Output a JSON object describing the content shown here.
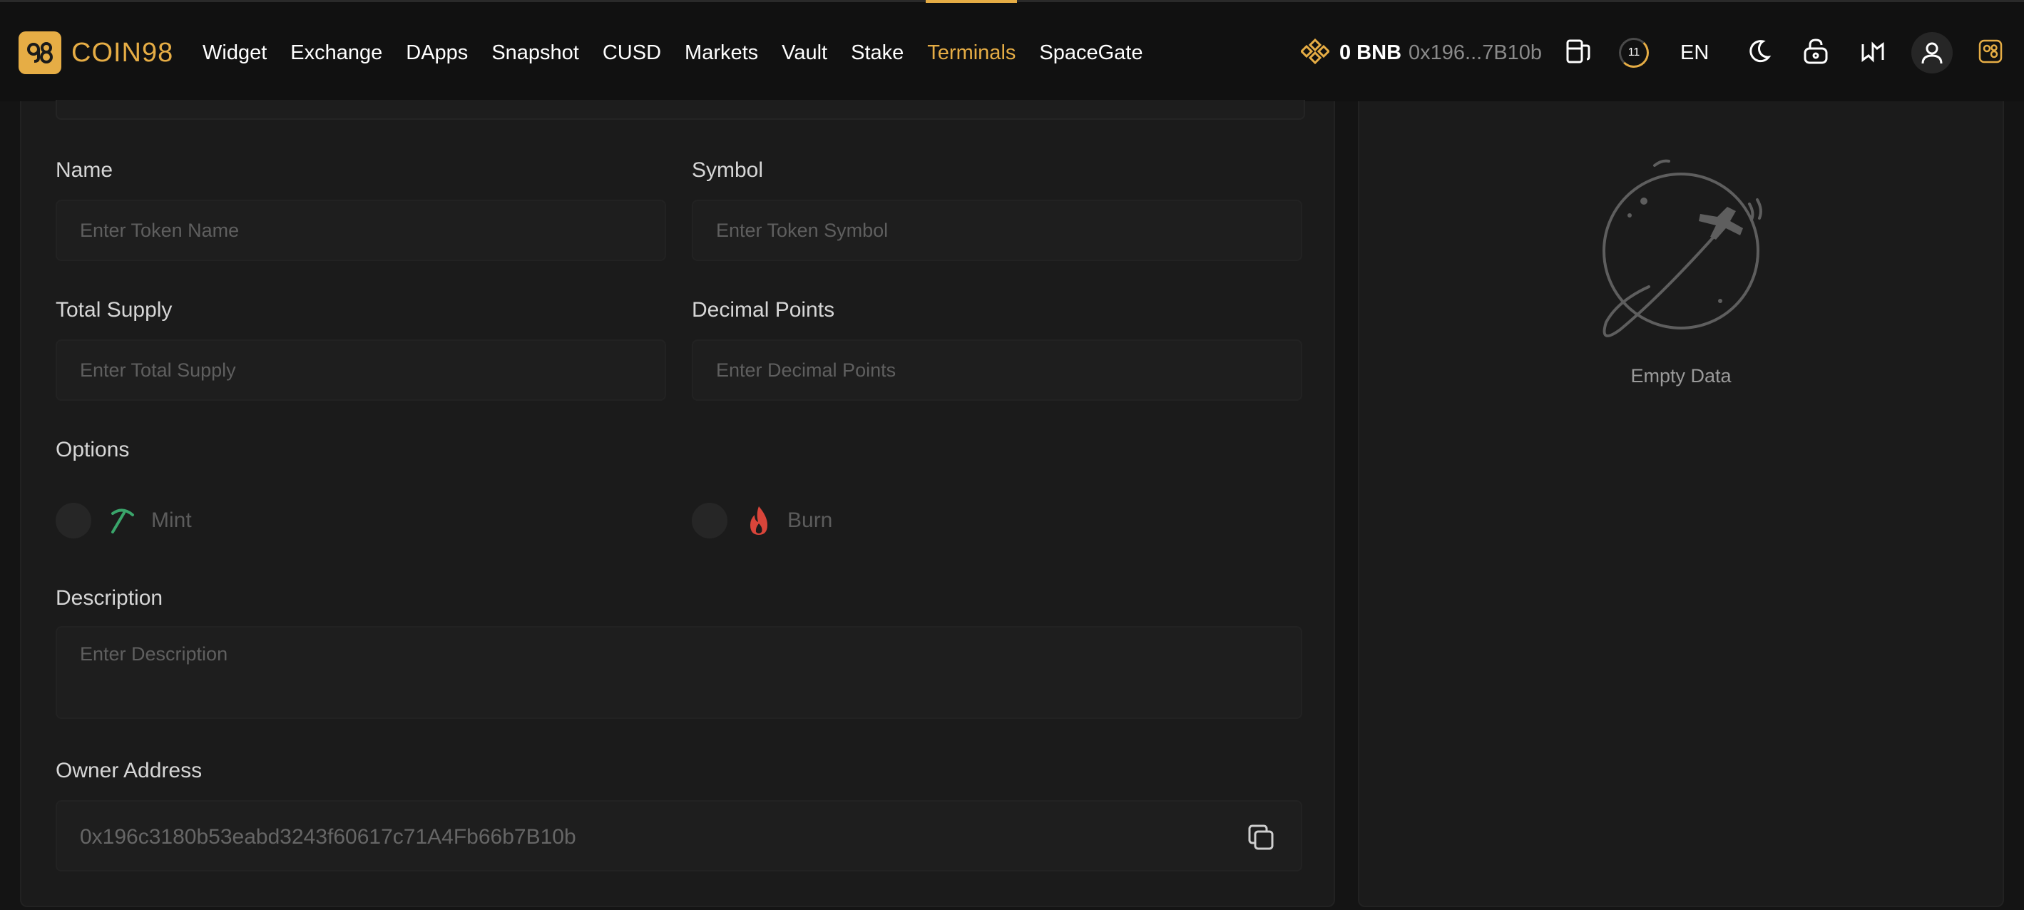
{
  "brand": {
    "logo_text": "COIN98",
    "accent": "#e6ad45"
  },
  "nav": {
    "items": [
      {
        "label": "Widget"
      },
      {
        "label": "Exchange"
      },
      {
        "label": "DApps"
      },
      {
        "label": "Snapshot"
      },
      {
        "label": "CUSD"
      },
      {
        "label": "Markets"
      },
      {
        "label": "Vault"
      },
      {
        "label": "Stake"
      },
      {
        "label": "Terminals",
        "active": true
      },
      {
        "label": "SpaceGate"
      }
    ]
  },
  "wallet": {
    "balance": "0 BNB",
    "address_short": "0x196...7B10b",
    "notification_count": "11",
    "language": "EN",
    "icons": [
      "bnb-coin-icon",
      "gas-pump-icon",
      "moon-icon",
      "unlock-icon",
      "bridge-icon",
      "user-icon",
      "coin98-app-icon"
    ]
  },
  "form": {
    "name": {
      "label": "Name",
      "placeholder": "Enter Token Name"
    },
    "symbol": {
      "label": "Symbol",
      "placeholder": "Enter Token Symbol"
    },
    "total_supply": {
      "label": "Total Supply",
      "placeholder": "Enter Total Supply"
    },
    "decimals": {
      "label": "Decimal Points",
      "placeholder": "Enter Decimal Points"
    },
    "options": {
      "label": "Options",
      "mint": {
        "label": "Mint",
        "color": "#3aa56b"
      },
      "burn": {
        "label": "Burn",
        "color": "#d9453a"
      }
    },
    "description": {
      "label": "Description",
      "placeholder": "Enter Description"
    },
    "owner": {
      "label": "Owner Address",
      "value": "0x196c3180b53eabd3243f60617c71A4Fb66b7B10b"
    }
  },
  "side_panel": {
    "empty_text": "Empty Data"
  }
}
